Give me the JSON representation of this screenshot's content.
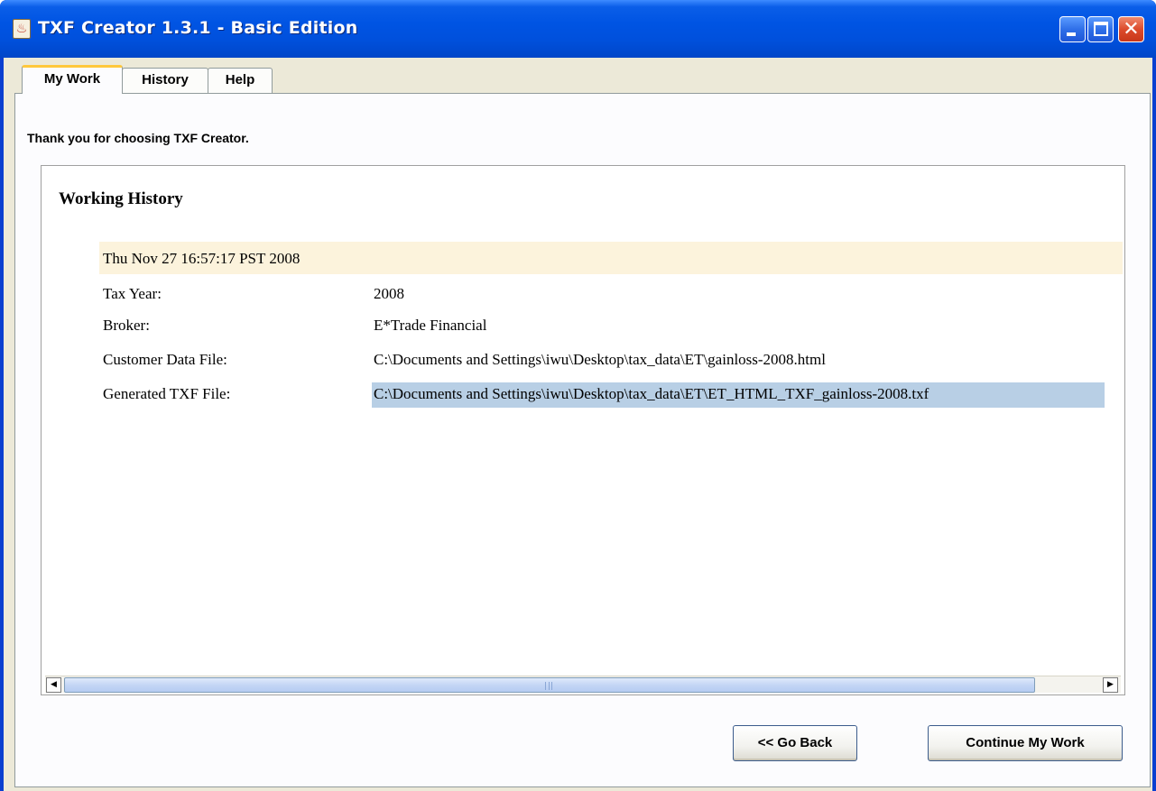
{
  "window": {
    "title": "TXF Creator 1.3.1 - Basic Edition",
    "app_icon": "java-cup-icon",
    "controls": {
      "minimize": "minimize-icon",
      "maximize": "maximize-icon",
      "close": "✕"
    }
  },
  "tabs": [
    {
      "label": "My Work",
      "active": true
    },
    {
      "label": "History",
      "active": false
    },
    {
      "label": "Help",
      "active": false
    }
  ],
  "main": {
    "greeting": "Thank you for choosing TXF Creator."
  },
  "history": {
    "title": "Working History",
    "entry": {
      "date": "Thu Nov 27 16:57:17 PST 2008",
      "rows": [
        {
          "label": "Tax Year:",
          "value": "2008"
        },
        {
          "label": "Broker:",
          "value": "E*Trade Financial"
        },
        {
          "label": "Customer Data File:",
          "value": "C:\\Documents and Settings\\iwu\\Desktop\\tax_data\\ET\\gainloss-2008.html"
        },
        {
          "label": "Generated TXF File:",
          "value": "C:\\Documents and Settings\\iwu\\Desktop\\tax_data\\ET\\ET_HTML_TXF_gainloss-2008.txf"
        }
      ]
    },
    "scrollbar": {
      "left_arrow": "◀",
      "right_arrow": "▶"
    }
  },
  "buttons": {
    "back": "<<  Go Back",
    "continue": "Continue My Work"
  },
  "colors": {
    "titlebar": "#0054e3",
    "client_bg": "#ece9d8",
    "entry_header_bg": "#fcf3dc",
    "selection_bg": "#b8cfe5",
    "active_tab_accent": "#ffc83c"
  }
}
